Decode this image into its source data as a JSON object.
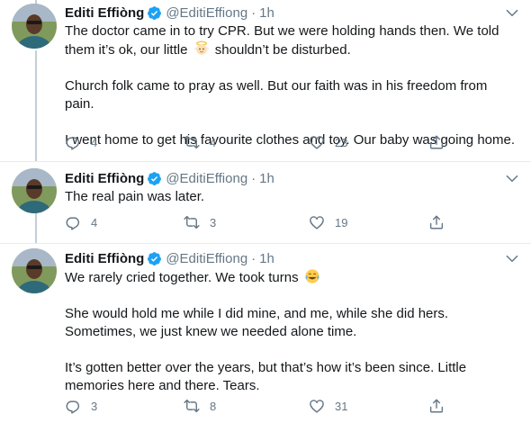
{
  "author": {
    "display_name": "Editi Effiòng",
    "handle": "@EditiEffiong",
    "separator": "·",
    "verified": true
  },
  "colors": {
    "text": "#14171a",
    "secondary": "#657786",
    "verified_blue": "#1da1f2",
    "divider": "#e6ecf0",
    "thread_line": "#c4cfd6"
  },
  "tweets": [
    {
      "time": "1h",
      "paragraphs": [
        {
          "before_emoji": "The doctor came in to try CPR. But we were holding hands then. We told them it’s ok, our little ",
          "emoji": "baby-angel-emoji",
          "after_emoji": " shouldn’t be disturbed."
        },
        {
          "text": "Church folk came to pray as well. But our faith was in his freedom from pain."
        },
        {
          "text": "I went home to get his favourite clothes and toy. Our baby was going home."
        }
      ],
      "replies": "4",
      "retweets": "4",
      "likes": "23"
    },
    {
      "time": "1h",
      "paragraphs": [
        {
          "text": "The real pain was later."
        }
      ],
      "replies": "4",
      "retweets": "3",
      "likes": "19"
    },
    {
      "time": "1h",
      "paragraphs": [
        {
          "before_emoji": "We rarely cried together. We took turns ",
          "emoji": "face-with-tears-of-joy-emoji",
          "after_emoji": ""
        },
        {
          "text": "She would hold me while I did mine, and me, while she did hers. Sometimes, we just knew we needed alone time."
        },
        {
          "text": "It’s gotten better over the years, but that’s how it’s been since. Little memories here and there. Tears."
        }
      ],
      "replies": "3",
      "retweets": "8",
      "likes": "31"
    }
  ]
}
